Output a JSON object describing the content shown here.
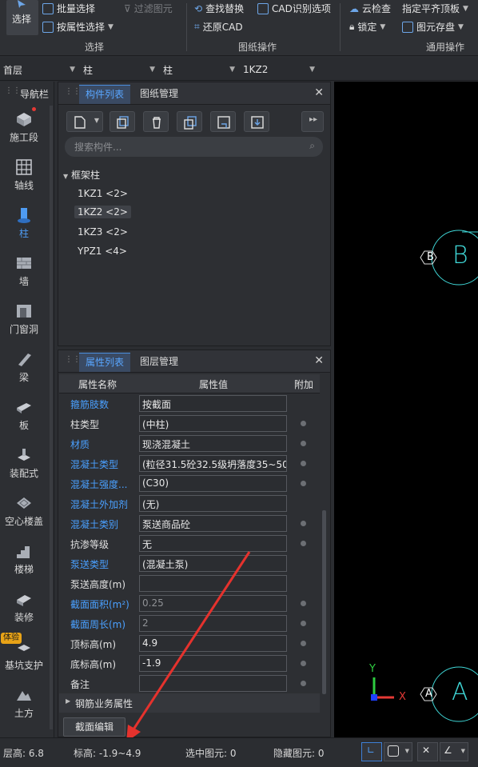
{
  "ribbon": {
    "groups": [
      {
        "label": "选择"
      },
      {
        "label": "图纸操作"
      },
      {
        "label": "通用操作"
      }
    ],
    "select_big": "选择",
    "batch_select": "批量选择",
    "attr_select": "按属性选择",
    "filter_elements": "过滤图元",
    "find_replace": "查找替换",
    "cad_options": "CAD识别选项",
    "restore_cad": "还原CAD",
    "cloud_check": "云检查",
    "align_top": "指定平齐顶板",
    "lock": "锁定",
    "save_elements": "图元存盘"
  },
  "filterbar": {
    "floor": "首层",
    "category": "柱",
    "type": "柱",
    "component": "1KZ2"
  },
  "navbar": {
    "title": "导航栏",
    "items": [
      {
        "label": "施工段",
        "icon": "construction-segment-icon"
      },
      {
        "label": "轴线",
        "icon": "axis-grid-icon"
      },
      {
        "label": "柱",
        "icon": "column-icon"
      },
      {
        "label": "墙",
        "icon": "wall-icon"
      },
      {
        "label": "门窗洞",
        "icon": "door-window-icon"
      },
      {
        "label": "梁",
        "icon": "beam-icon"
      },
      {
        "label": "板",
        "icon": "slab-icon"
      },
      {
        "label": "装配式",
        "icon": "prefab-icon"
      },
      {
        "label": "空心楼盖",
        "icon": "hollow-floor-icon"
      },
      {
        "label": "楼梯",
        "icon": "stairs-icon"
      },
      {
        "label": "装修",
        "icon": "decoration-icon"
      },
      {
        "label": "基坑支护",
        "icon": "pit-support-icon",
        "badge": "体验"
      },
      {
        "label": "土方",
        "icon": "earthwork-icon"
      }
    ]
  },
  "component_panel": {
    "tabs": [
      "构件列表",
      "图纸管理"
    ],
    "search_placeholder": "搜索构件...",
    "tree": {
      "group": "框架柱",
      "items": [
        "1KZ1 <2>",
        "1KZ2 <2>",
        "1KZ3 <2>",
        "YPZ1 <4>"
      ],
      "selected": "1KZ2 <2>"
    }
  },
  "property_panel": {
    "tabs": [
      "属性列表",
      "图层管理"
    ],
    "headers": [
      "属性名称",
      "属性值",
      "附加"
    ],
    "rows": [
      {
        "name": "箍筋肢数",
        "value": "按截面",
        "blue": true,
        "dot": false,
        "dim": false
      },
      {
        "name": "柱类型",
        "value": "(中柱)",
        "blue": false,
        "dot": true,
        "dim": false
      },
      {
        "name": "材质",
        "value": "现浇混凝土",
        "blue": true,
        "dot": true,
        "dim": false
      },
      {
        "name": "混凝土类型",
        "value": "(粒径31.5砼32.5级坍落度35~50)",
        "blue": true,
        "dot": true,
        "dim": false
      },
      {
        "name": "混凝土强度...",
        "value": "(C30)",
        "blue": true,
        "dot": true,
        "dim": false
      },
      {
        "name": "混凝土外加剂",
        "value": "(无)",
        "blue": true,
        "dot": false,
        "dim": false
      },
      {
        "name": "混凝土类别",
        "value": "泵送商品砼",
        "blue": true,
        "dot": true,
        "dim": false
      },
      {
        "name": "抗渗等级",
        "value": "无",
        "blue": false,
        "dot": true,
        "dim": false
      },
      {
        "name": "泵送类型",
        "value": "(混凝土泵)",
        "blue": true,
        "dot": false,
        "dim": false
      },
      {
        "name": "泵送高度(m)",
        "value": "",
        "blue": false,
        "dot": false,
        "dim": false
      },
      {
        "name": "截面面积(m²)",
        "value": "0.25",
        "blue": true,
        "dot": true,
        "dim": true
      },
      {
        "name": "截面周长(m)",
        "value": "2",
        "blue": true,
        "dot": true,
        "dim": true
      },
      {
        "name": "顶标高(m)",
        "value": "4.9",
        "blue": false,
        "dot": true,
        "dim": false
      },
      {
        "name": "底标高(m)",
        "value": "-1.9",
        "blue": false,
        "dot": true,
        "dim": false
      },
      {
        "name": "备注",
        "value": "",
        "blue": false,
        "dot": true,
        "dim": false
      }
    ],
    "steel_group": "钢筋业务属性",
    "section_edit": "截面编辑"
  },
  "canvas": {
    "axis_b": "B",
    "axis_a": "A",
    "axis_y": "Y",
    "axis_x": "X"
  },
  "statusbar": {
    "floor_height": "层高:  6.8",
    "elevation": "标高:  -1.9~4.9",
    "selected": "选中图元:  0",
    "hidden": "隐藏图元:  0"
  },
  "colors": {
    "accent": "#4aa0ff",
    "annotation_arrow": "#e5322d",
    "canvas": "#000000",
    "axis_cyan": "#3fd6d6"
  }
}
